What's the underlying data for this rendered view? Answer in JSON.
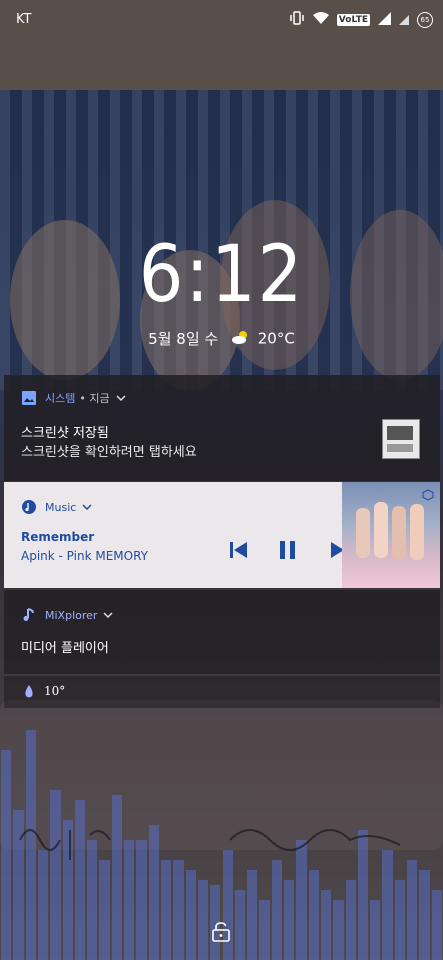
{
  "status_bar": {
    "carrier": "KT",
    "network_badge": "VoLTE",
    "battery": "65",
    "icons": [
      "vibrate-icon",
      "wifi-icon",
      "volte-icon",
      "signal-icon",
      "signal-icon",
      "battery-icon"
    ]
  },
  "lockscreen": {
    "time": "6:12",
    "date": "5월 8일 수",
    "temperature": "20°C",
    "weather_icon": "cloud-sun-icon"
  },
  "notifications": {
    "system": {
      "app": "시스템",
      "time": "• 지금",
      "title": "스크린샷 저장됨",
      "text": "스크린샷을 확인하려면 탭하세요",
      "accent": "#6fa0ff"
    },
    "music": {
      "app": "Music",
      "track": "Remember",
      "artist_album": "Apink - Pink MEMORY",
      "accent": "#1f4c9e"
    },
    "mixplorer": {
      "app": "MiXplorer",
      "text": "미디어 플레이어",
      "accent": "#8ea0ff"
    },
    "weather": {
      "value": "10°"
    }
  }
}
